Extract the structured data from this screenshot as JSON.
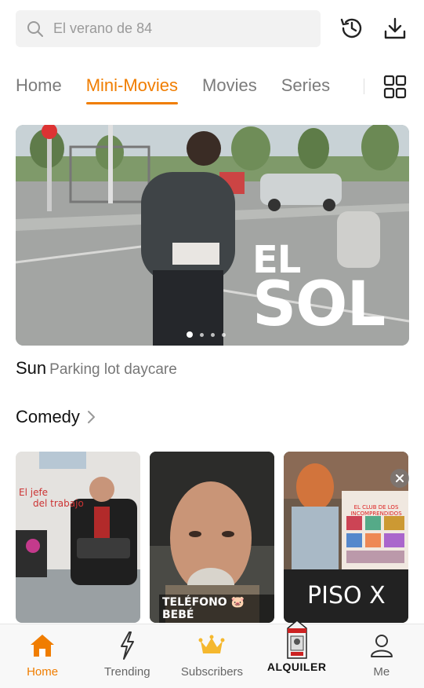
{
  "search": {
    "placeholder": "El verano de 84"
  },
  "top_actions": {
    "history_icon": "history-icon",
    "download_icon": "download-icon"
  },
  "tabs": [
    {
      "label": "Home",
      "active": false
    },
    {
      "label": "Mini-Movies",
      "active": true
    },
    {
      "label": "Movies",
      "active": false
    },
    {
      "label": "Series",
      "active": false
    }
  ],
  "accent_color": "#f07d00",
  "banner": {
    "overlay_line1": "EL",
    "overlay_line2": "SOL",
    "title": "Sun",
    "subtitle": "Parking lot daycare",
    "slide_count": 4,
    "active_slide": 1
  },
  "section": {
    "label": "Comedy"
  },
  "posters": [
    {
      "text1": "El jefe",
      "text2": "del trabajo"
    },
    {
      "text": "TELÉFONO 🐷 BEBÉ"
    },
    {
      "text1": "EL CLUB DE LOS",
      "text2": "INCOMPRENDIDOS",
      "text3": "PISO X"
    }
  ],
  "bottom_nav": [
    {
      "label": "Home",
      "icon": "home-icon",
      "active": true
    },
    {
      "label": "Trending",
      "icon": "lightning-icon",
      "active": false
    },
    {
      "label": "Subscribers",
      "icon": "crown-icon",
      "active": false
    },
    {
      "label": "ALQUILER",
      "icon": "milk-carton-icon",
      "active": false
    },
    {
      "label": "Me",
      "icon": "person-icon",
      "active": false
    }
  ]
}
